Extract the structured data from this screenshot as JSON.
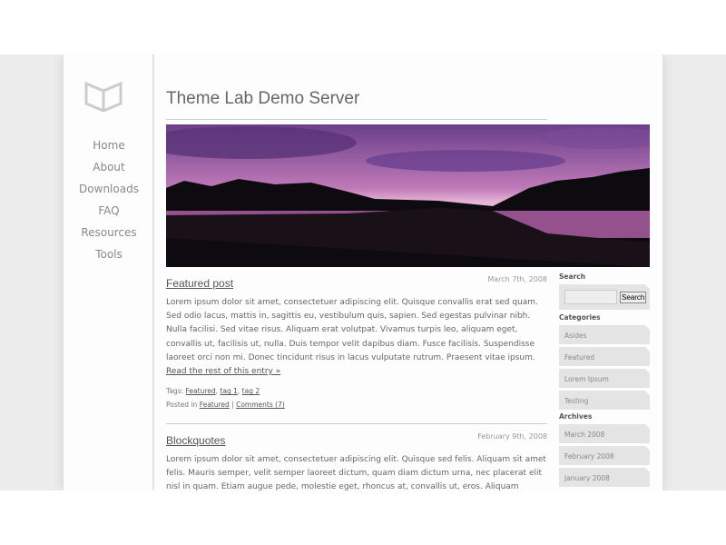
{
  "site_title": "Theme Lab Demo Server",
  "nav": [
    "Home",
    "About",
    "Downloads",
    "FAQ",
    "Resources",
    "Tools"
  ],
  "posts": [
    {
      "title": "Featured post",
      "date": "March 7th, 2008",
      "body": "Lorem ipsum dolor sit amet, consectetuer adipiscing elit. Quisque convallis erat sed quam. Sed odio lacus, mattis in, sagittis eu, vestibulum quis, sapien. Sed egestas pulvinar nibh. Nulla facilisi. Sed vitae risus. Aliquam erat volutpat. Vivamus turpis leo, aliquam eget, convallis ut, facilisis ut, nulla. Duis tempor velit dapibus diam. Fusce facilisis. Suspendisse laoreet orci non mi. Donec tincidunt risus in lacus vulputate rutrum. Praesent vitae ipsum.",
      "more": "Read the rest of this entry »",
      "tags_label": "Tags:",
      "tags": [
        "Featured",
        "tag 1",
        "tag 2"
      ],
      "posted_in": "Posted in",
      "category": "Featured",
      "sep": "|",
      "comments": "Comments (7)"
    },
    {
      "title": "Blockquotes",
      "date": "February 9th, 2008",
      "body": "Lorem ipsum dolor sit amet, consectetuer adipiscing elit. Quisque sed felis. Aliquam sit amet felis. Mauris semper, velit semper laoreet dictum, quam diam dictum urna, nec placerat elit nisl in quam. Etiam augue pede, molestie eget, rhoncus at, convallis ut, eros. Aliquam pharetra. Nulla in tellus"
    }
  ],
  "sidebar": {
    "search_heading": "Search",
    "search_value": "",
    "search_button": "Search",
    "categories_heading": "Categories",
    "categories": [
      "Asides",
      "Featured",
      "Lorem Ipsum",
      "Testing"
    ],
    "archives_heading": "Archives",
    "archives": [
      "March 2008",
      "February 2008",
      "January 2008"
    ]
  }
}
